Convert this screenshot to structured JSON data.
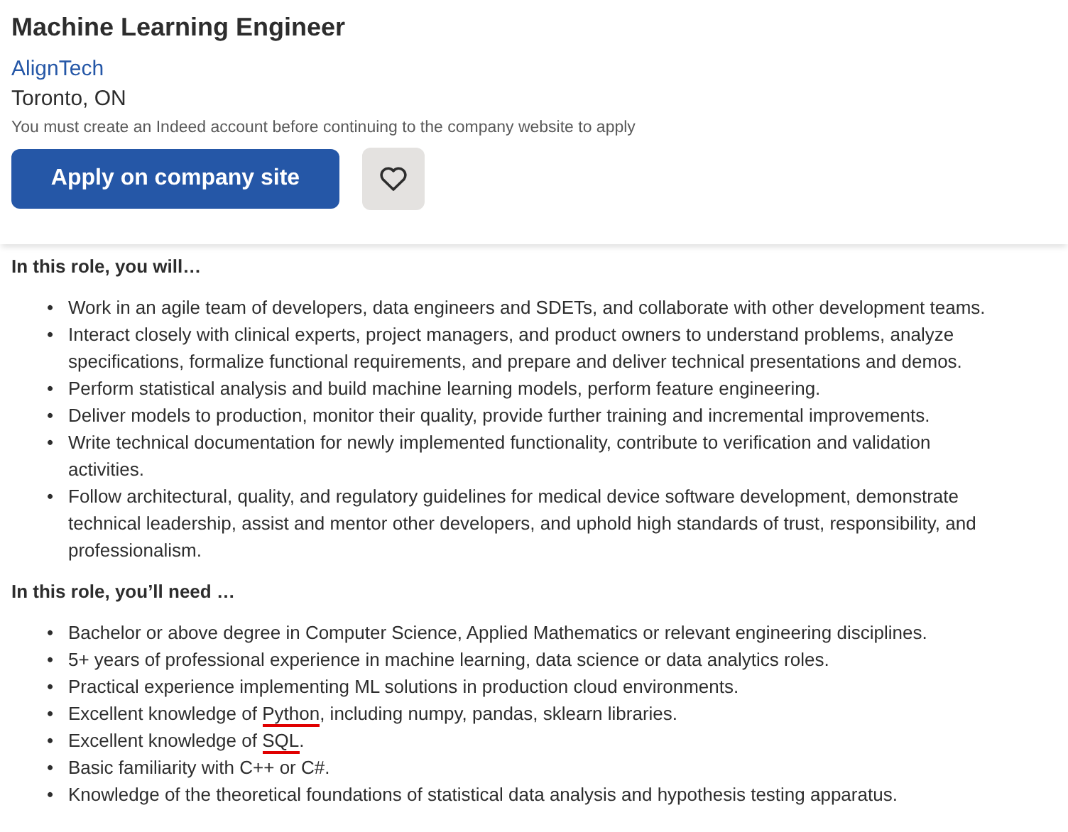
{
  "job": {
    "title": "Machine Learning Engineer",
    "company": "AlignTech",
    "location": "Toronto, ON",
    "notice": "You must create an Indeed account before continuing to the company website to apply",
    "apply_button": "Apply on company site",
    "saved": false
  },
  "sections": [
    {
      "heading": "In this role, you will…",
      "items": [
        {
          "marker": "•",
          "parts": [
            {
              "text": "Work in an agile team of developers, data engineers and SDETs, and collaborate with other development teams.",
              "marked": false
            }
          ]
        },
        {
          "marker": "•",
          "parts": [
            {
              "text": "Interact closely with clinical experts, project managers, and product owners to understand problems, analyze specifications, formalize functional requirements, and prepare and deliver technical presentations and demos.",
              "marked": false
            }
          ]
        },
        {
          "marker": "•",
          "parts": [
            {
              "text": "Perform statistical analysis and build machine learning models, perform feature engineering.",
              "marked": false
            }
          ]
        },
        {
          "marker": "•",
          "parts": [
            {
              "text": "Deliver models to production, monitor their quality, provide further training and incremental improvements.",
              "marked": false
            }
          ]
        },
        {
          "marker": "•",
          "parts": [
            {
              "text": "Write technical documentation for newly implemented functionality, contribute to verification and validation activities.",
              "marked": false
            }
          ]
        },
        {
          "marker": "•",
          "parts": [
            {
              "text": "Follow architectural, quality, and regulatory guidelines for medical device software development, demonstrate technical leadership, assist and mentor other developers, and uphold high standards of trust, responsibility, and professionalism.",
              "marked": false
            }
          ]
        }
      ]
    },
    {
      "heading": "In this role, you’ll need …",
      "items": [
        {
          "marker": "•",
          "parts": [
            {
              "text": "Bachelor or above degree in Computer Science, Applied Mathematics or relevant engineering disciplines.",
              "marked": false
            }
          ]
        },
        {
          "marker": "•",
          "parts": [
            {
              "text": "5+ years of professional experience in machine learning, data science or data analytics roles.",
              "marked": false
            }
          ]
        },
        {
          "marker": "•",
          "parts": [
            {
              "text": "Practical experience implementing ML solutions in production cloud environments.",
              "marked": false
            }
          ]
        },
        {
          "marker": "•",
          "parts": [
            {
              "text": "Excellent knowledge of ",
              "marked": false
            },
            {
              "text": "Python",
              "marked": true
            },
            {
              "text": ", including numpy, pandas, sklearn libraries.",
              "marked": false
            }
          ]
        },
        {
          "marker": "•",
          "parts": [
            {
              "text": "Excellent knowledge of ",
              "marked": false
            },
            {
              "text": "SQL",
              "marked": true
            },
            {
              "text": ".",
              "marked": false
            }
          ]
        },
        {
          "marker": "•",
          "parts": [
            {
              "text": "Basic familiarity with C++ or C#.",
              "marked": false
            }
          ]
        },
        {
          "marker": "•",
          "parts": [
            {
              "text": "Knowledge of the theoretical foundations of statistical data analysis and hypothesis testing apparatus.",
              "marked": false
            }
          ]
        }
      ]
    }
  ]
}
